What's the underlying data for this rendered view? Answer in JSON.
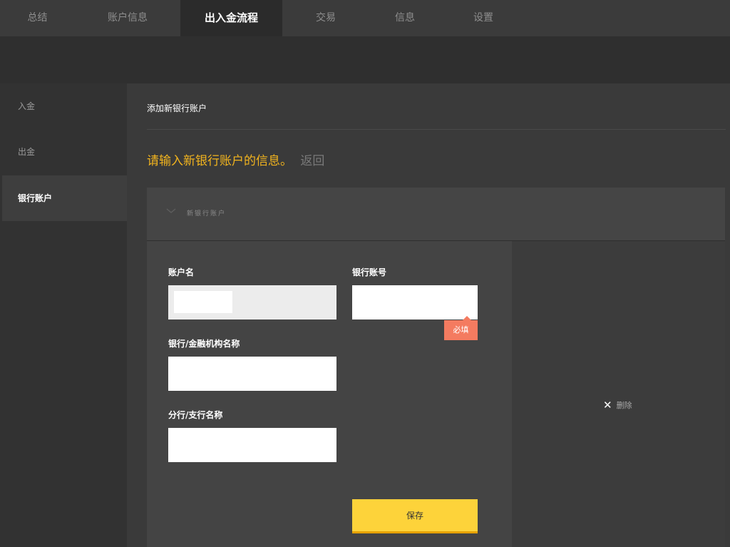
{
  "tabs": [
    {
      "label": "总结"
    },
    {
      "label": "账户信息"
    },
    {
      "label": "出入金流程",
      "active": true
    },
    {
      "label": "交易"
    },
    {
      "label": "信息"
    },
    {
      "label": "设置"
    }
  ],
  "sidebar": {
    "items": [
      {
        "label": "入金"
      },
      {
        "label": "出金"
      },
      {
        "label": "银行账户",
        "active": true
      }
    ]
  },
  "main": {
    "title": "添加新银行账户",
    "prompt": "请输入新银行账户的信息。",
    "back_label": "返回",
    "section": {
      "label": "新银行账户",
      "icon": "chevron-down-icon"
    }
  },
  "form": {
    "account_name_label": "账户名",
    "account_name_value": "",
    "bank_account_number_label": "银行账号",
    "bank_account_number_value": "",
    "required_label": "必填",
    "bank_name_label": "银行/金融机构名称",
    "bank_name_value": "",
    "branch_name_label": "分行/支行名称",
    "branch_name_value": "",
    "save_label": "保存",
    "delete_label": "删除",
    "delete_icon": "close-icon"
  },
  "colors": {
    "accent_yellow": "#f2b41e",
    "button_yellow": "#fdd33a",
    "required_badge": "#f47b60"
  }
}
